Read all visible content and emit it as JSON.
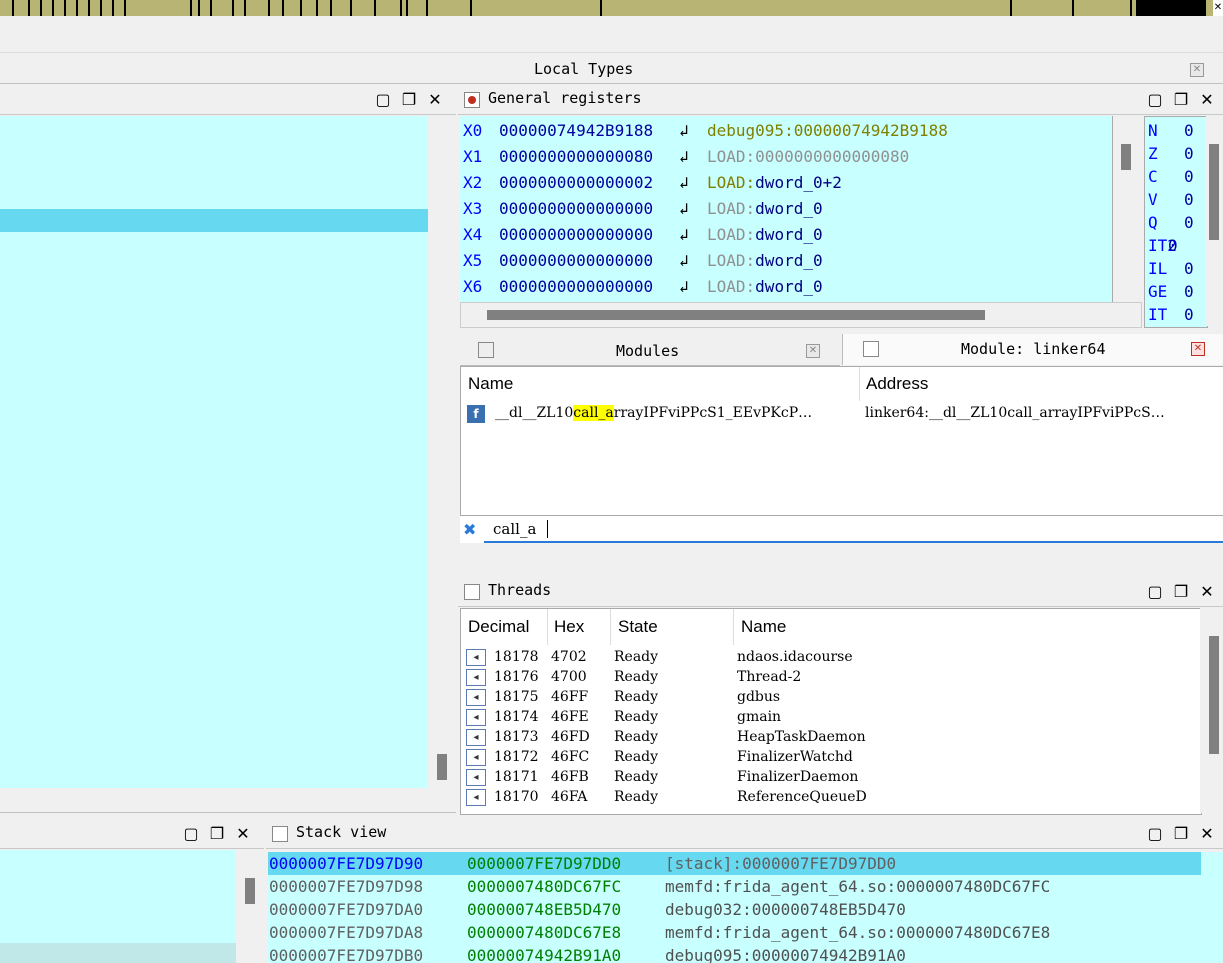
{
  "local_types": {
    "title": "Local Types"
  },
  "general_registers": {
    "title": "General registers",
    "registers": [
      {
        "name": "X0",
        "value": "00000074942B9188",
        "ref_prefix": "debug095:",
        "ref_rest": "00000074942B9188"
      },
      {
        "name": "X1",
        "value": "0000000000000080",
        "ref_prefix": "LOAD:",
        "ref_rest": "0000000000000080"
      },
      {
        "name": "X2",
        "value": "0000000000000002",
        "ref_prefix": "LOAD:",
        "ref_rest": "dword_0+2"
      },
      {
        "name": "X3",
        "value": "0000000000000000",
        "ref_prefix": "LOAD:",
        "ref_rest": "dword_0"
      },
      {
        "name": "X4",
        "value": "0000000000000000",
        "ref_prefix": "LOAD:",
        "ref_rest": "dword_0"
      },
      {
        "name": "X5",
        "value": "0000000000000000",
        "ref_prefix": "LOAD:",
        "ref_rest": "dword_0"
      },
      {
        "name": "X6",
        "value": "0000000000000000",
        "ref_prefix": "LOAD:",
        "ref_rest": "dword_0"
      }
    ],
    "flags": [
      {
        "name": "N",
        "value": "0"
      },
      {
        "name": "Z",
        "value": "0"
      },
      {
        "name": "C",
        "value": "0"
      },
      {
        "name": "V",
        "value": "0"
      },
      {
        "name": "Q",
        "value": "0"
      },
      {
        "name": "IT2",
        "value": "0"
      },
      {
        "name": "IL",
        "value": "0"
      },
      {
        "name": "GE",
        "value": "0"
      },
      {
        "name": "IT",
        "value": "0"
      }
    ]
  },
  "modules": {
    "tab_label": "Modules",
    "module_tab_label": "Module: linker64",
    "columns": {
      "name": "Name",
      "address": "Address"
    },
    "row": {
      "name_before": "__dl__ZL10",
      "name_highlight": "call_a",
      "name_after": "rrayIPFviPPcS1_EEvPKcP…",
      "address": "linker64:__dl__ZL10call_arrayIPFviPPcS…"
    },
    "filter_value": "call_a"
  },
  "threads": {
    "title": "Threads",
    "columns": {
      "decimal": "Decimal",
      "hex": "Hex",
      "state": "State",
      "name": "Name"
    },
    "rows": [
      {
        "decimal": "18178",
        "hex": "4702",
        "state": "Ready",
        "name": "ndaos.idacourse"
      },
      {
        "decimal": "18176",
        "hex": "4700",
        "state": "Ready",
        "name": "Thread-2"
      },
      {
        "decimal": "18175",
        "hex": "46FF",
        "state": "Ready",
        "name": "gdbus"
      },
      {
        "decimal": "18174",
        "hex": "46FE",
        "state": "Ready",
        "name": "gmain"
      },
      {
        "decimal": "18173",
        "hex": "46FD",
        "state": "Ready",
        "name": "HeapTaskDaemon"
      },
      {
        "decimal": "18172",
        "hex": "46FC",
        "state": "Ready",
        "name": "FinalizerWatchd"
      },
      {
        "decimal": "18171",
        "hex": "46FB",
        "state": "Ready",
        "name": "FinalizerDaemon"
      },
      {
        "decimal": "18170",
        "hex": "46FA",
        "state": "Ready",
        "name": "ReferenceQueueD"
      }
    ]
  },
  "stack_view": {
    "title": "Stack view",
    "rows": [
      {
        "addr": "0000007FE7D97D90",
        "value": "0000007FE7D97DD0",
        "ref": "[stack]:0000007FE7D97DD0"
      },
      {
        "addr": "0000007FE7D97D98",
        "value": "0000007480DC67FC",
        "ref": "memfd:frida_agent_64.so:0000007480DC67FC"
      },
      {
        "addr": "0000007FE7D97DA0",
        "value": "000000748EB5D470",
        "ref": "debug032:000000748EB5D470"
      },
      {
        "addr": "0000007FE7D97DA8",
        "value": "0000007480DC67E8",
        "ref": "memfd:frida_agent_64.so:0000007480DC67E8"
      },
      {
        "addr": "0000007FE7D97DB0",
        "value": "00000074942B91A0",
        "ref": "debug095:00000074942B91A0"
      }
    ]
  },
  "colors": {
    "panel_bg": "#c8ffff",
    "selection": "#66d9f0",
    "highlight": "#ffff00",
    "register_name": "#0000ff"
  }
}
